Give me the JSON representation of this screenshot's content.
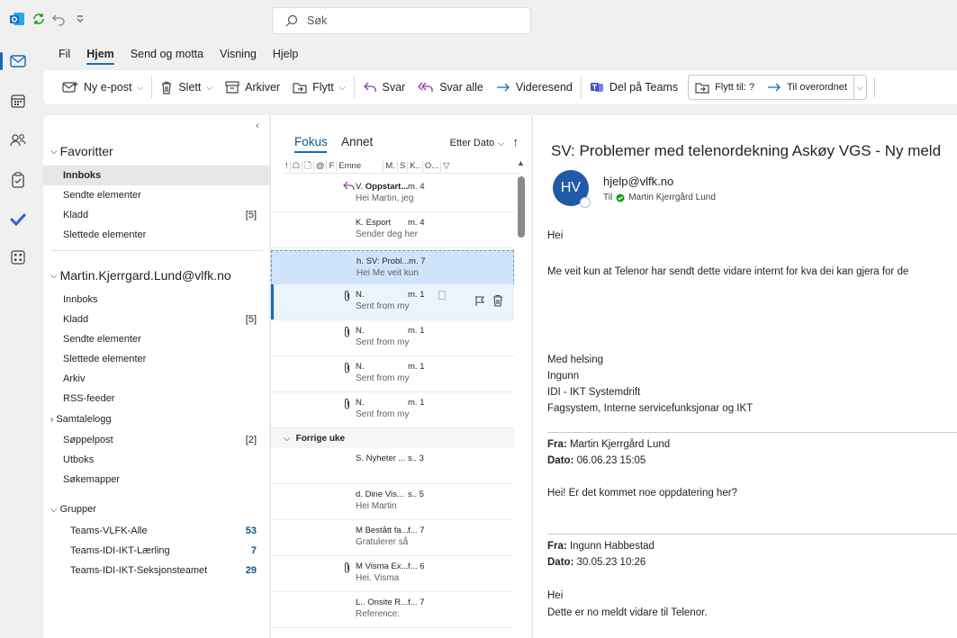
{
  "search": {
    "placeholder": "Søk"
  },
  "menu": {
    "tabs": [
      "Fil",
      "Hjem",
      "Send og motta",
      "Visning",
      "Hjelp"
    ]
  },
  "ribbon": {
    "new_mail": "Ny e-post",
    "delete": "Slett",
    "archive": "Arkiver",
    "move": "Flytt",
    "reply": "Svar",
    "reply_all": "Svar alle",
    "forward": "Videresend",
    "share_teams": "Del på Teams",
    "move_to": "Flytt til: ?",
    "to_manager": "Til overordnet"
  },
  "folders": {
    "favorites": {
      "title": "Favoritter",
      "items": [
        {
          "label": "Innboks",
          "count": ""
        },
        {
          "label": "Sendte elementer",
          "count": ""
        },
        {
          "label": "Kladd",
          "count": "[5]"
        },
        {
          "label": "Slettede elementer",
          "count": ""
        }
      ]
    },
    "account": {
      "title": "Martin.Kjerrgard.Lund@vlfk.no",
      "items": [
        {
          "label": "Innboks",
          "count": ""
        },
        {
          "label": "Kladd",
          "count": "[5]"
        },
        {
          "label": "Sendte elementer",
          "count": ""
        },
        {
          "label": "Slettede elementer",
          "count": ""
        },
        {
          "label": "Arkiv",
          "count": ""
        },
        {
          "label": "RSS-feeder",
          "count": ""
        }
      ],
      "conversation_log": "Samtalelogg",
      "items2": [
        {
          "label": "Søppelpost",
          "count": "[2]"
        },
        {
          "label": "Utboks",
          "count": ""
        },
        {
          "label": "Søkemapper",
          "count": ""
        }
      ]
    },
    "groups": {
      "title": "Grupper",
      "items": [
        {
          "label": "Teams-VLFK-Alle",
          "count": "53"
        },
        {
          "label": "Teams-IDI-IKT-Lærling",
          "count": "7"
        },
        {
          "label": "Teams-IDI-IKT-Seksjonsteamet",
          "count": "29"
        }
      ]
    }
  },
  "list": {
    "tab_focus": "Fokus",
    "tab_other": "Annet",
    "sort_label": "Etter Dato",
    "columns": [
      "!",
      "☖",
      "🗋",
      "@",
      "F",
      "Emne",
      "M.",
      "S",
      "K..",
      "O...",
      "▽"
    ],
    "messages": [
      {
        "from": "V.",
        "subject": "Oppstart...",
        "date": "m. 4",
        "preview": "Hei Martin, jeg"
      },
      {
        "from": "K.",
        "subject": "Esport",
        "date": "m. 4",
        "preview": "Sender deg her"
      },
      {
        "from": "h.",
        "subject": "SV: Probl...",
        "date": "m. 7",
        "preview": "Hei  Me veit kun"
      },
      {
        "from": "N.",
        "subject": "",
        "date": "m. 1",
        "preview": "Sent from my"
      },
      {
        "from": "N.",
        "subject": "",
        "date": "m. 1",
        "preview": "Sent from my"
      },
      {
        "from": "N.",
        "subject": "",
        "date": "m. 1",
        "preview": "Sent from my"
      },
      {
        "from": "N.",
        "subject": "",
        "date": "m. 1",
        "preview": "Sent from my"
      }
    ],
    "group_label": "Forrige uke",
    "messages2": [
      {
        "from": "S.",
        "subject": "Nyheter ...",
        "date": "s.. 3",
        "preview": ""
      },
      {
        "from": "d.",
        "subject": "Dine Vis...",
        "date": "s.. 5",
        "preview": "Hei Martin"
      },
      {
        "from": "M",
        "subject": "Bestått fa...",
        "date": "f... 7",
        "preview": "Gratulerer så"
      },
      {
        "from": "M",
        "subject": "Visma Ex...",
        "date": "f... 6",
        "preview": "Hei.  Visma"
      },
      {
        "from": "L..",
        "subject": "Onsite R...",
        "date": "f... 7",
        "preview": "Reference:"
      }
    ]
  },
  "reading": {
    "subject": "SV: Problemer med telenordekning Askøy VGS - Ny meld",
    "avatar_initials": "HV",
    "sender": "hjelp@vlfk.no",
    "to_label": "Til",
    "recipient": "Martin Kjerrgård Lund",
    "body": {
      "greeting": "Hei",
      "line1": "Me veit kun at Telenor har sendt dette vidare internt for kva dei kan gjera for de",
      "signoff": "Med helsing",
      "name": "Ingunn",
      "dept": "IDI - IKT Systemdrift",
      "unit": "Fagsystem, Interne servicefunksjonar og IKT",
      "q1_from_label": "Fra:",
      "q1_from": "Martin Kjerrgård Lund",
      "q1_date_label": "Dato:",
      "q1_date": "06.06.23 15:05",
      "q1_text": "Hei! Er det kommet noe oppdatering her?",
      "q2_from_label": "Fra:",
      "q2_from": "Ingunn Habbestad",
      "q2_date_label": "Dato:",
      "q2_date": "30.05.23 10:26",
      "q2_greeting": "Hei",
      "q2_text": "Dette er no meldt vidare til Telenor."
    }
  },
  "colors": {
    "accent": "#0f6cbd",
    "selected": "#cfe4fa",
    "avatar": "#1e5aa8",
    "presence": "#13a10e"
  }
}
